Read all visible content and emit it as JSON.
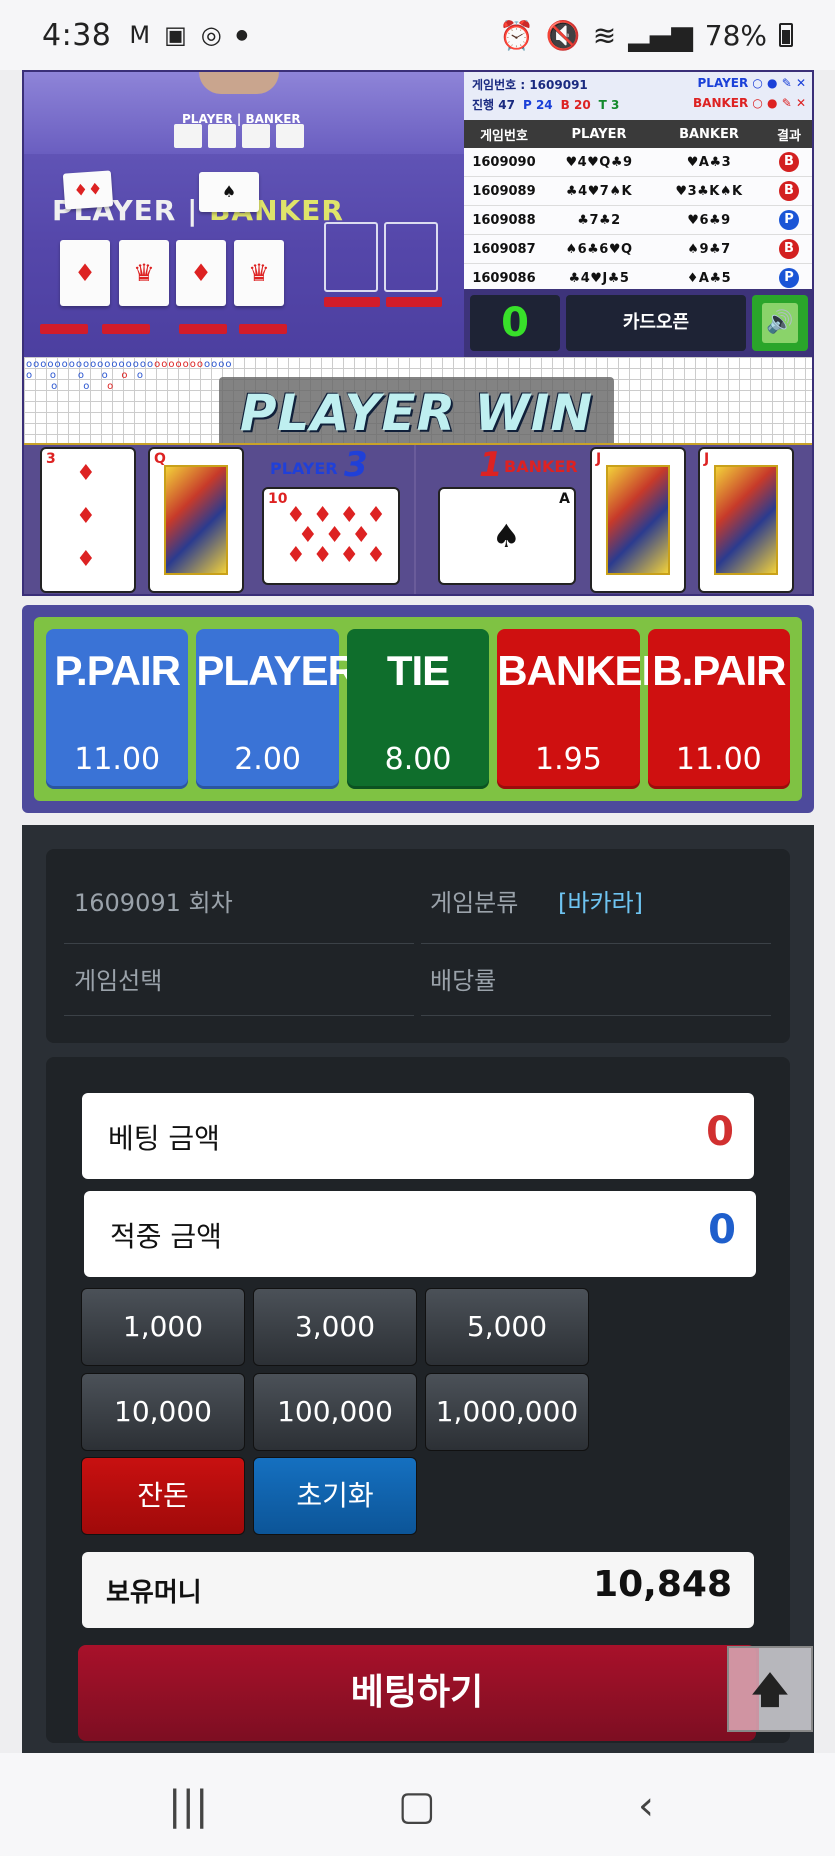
{
  "status_bar": {
    "time": "4:38",
    "battery": "78%"
  },
  "game": {
    "mini_label": "PLAYER | BANKER",
    "table_label_player": "PLAYER",
    "table_label_banker": "BANKER",
    "win_text": "PLAYER WIN",
    "round_info": "게임번호 : 1609091",
    "progress": "진행 47",
    "p_count": "P 24",
    "b_count": "B 20",
    "t_count": "T 3",
    "legend_player": "PLAYER",
    "legend_banker": "BANKER",
    "history_headers": [
      "게임번호",
      "PLAYER",
      "BANKER",
      "결과"
    ],
    "history": [
      {
        "no": "1609090",
        "player": "♥4♥Q♣9",
        "banker": "♥A♣3",
        "result": "B"
      },
      {
        "no": "1609089",
        "player": "♣4♥7♠K",
        "banker": "♥3♣K♠K",
        "result": "B"
      },
      {
        "no": "1609088",
        "player": "♣7♣2",
        "banker": "♥6♣9",
        "result": "P"
      },
      {
        "no": "1609087",
        "player": "♠6♣6♥Q",
        "banker": "♠9♣7",
        "result": "B"
      },
      {
        "no": "1609086",
        "player": "♣4♥J♣5",
        "banker": "♦A♣5",
        "result": "P"
      }
    ],
    "counter": "0",
    "open_label": "카드오픈",
    "player_label": "PLAYER",
    "player_score": "3",
    "banker_label": "BANKER",
    "banker_score": "1",
    "player_cards": [
      "3",
      "Q",
      "10"
    ],
    "banker_cards": [
      "A",
      "J",
      "J"
    ]
  },
  "bet_options": [
    {
      "name": "P.PAIR",
      "rate": "11.00",
      "color": "#3a73d6"
    },
    {
      "name": "PLAYER",
      "rate": "2.00",
      "color": "#3a73d6"
    },
    {
      "name": "TIE",
      "rate": "8.00",
      "color": "#0f6e2c"
    },
    {
      "name": "BANKER",
      "rate": "1.95",
      "color": "#cf1010"
    },
    {
      "name": "B.PAIR",
      "rate": "11.00",
      "color": "#cf1010"
    }
  ],
  "info": {
    "round": "1609091 회차",
    "category_label": "게임분류",
    "category_value": "[바카라]",
    "select_label": "게임선택",
    "odds_label": "배당률"
  },
  "bet": {
    "bet_amount_label": "베팅 금액",
    "bet_amount_value": "0",
    "win_amount_label": "적중 금액",
    "win_amount_value": "0",
    "chips": [
      "1,000",
      "3,000",
      "5,000",
      "10,000",
      "100,000",
      "1,000,000"
    ],
    "remain_label": "잔돈",
    "reset_label": "초기화",
    "money_label": "보유머니",
    "money_value": "10,848",
    "submit_label": "베팅하기"
  }
}
